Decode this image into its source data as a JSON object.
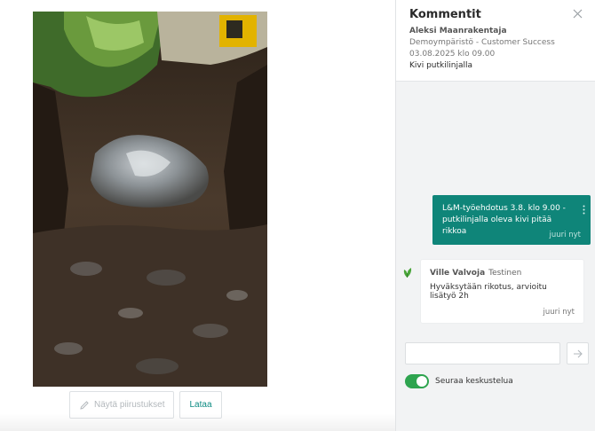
{
  "viewer": {
    "show_drawings_label": "Näytä piirustukset",
    "download_label": "Lataa"
  },
  "comments": {
    "title": "Kommentit",
    "author": "Aleksi Maanrakentaja",
    "environment": "Demoympäristö - Customer Success",
    "date": "03.08.2025 klo 09.00",
    "subject": "Kivi putkilinjalla",
    "messages": [
      {
        "text": "L&M-työehdotus 3.8. klo 9.00 - putkilinjalla oleva kivi pitää rikkoa",
        "time": "juuri nyt"
      },
      {
        "author": "Ville Valvoja",
        "role": "Testinen",
        "text": "Hyväksytään rikotus, arvioitu lisätyö 2h",
        "time": "juuri nyt"
      }
    ],
    "input_value": "",
    "follow_label": "Seuraa keskustelua",
    "follow_on": true
  },
  "colors": {
    "accent": "#0f8579",
    "toggle": "#2ea44f",
    "panel_bg": "#f2f3f4"
  },
  "icons": {
    "close": "close-icon",
    "pencil": "pencil-icon",
    "send": "arrow-right-icon",
    "more": "more-vertical-icon",
    "avatar": "leaf-avatar-icon"
  }
}
